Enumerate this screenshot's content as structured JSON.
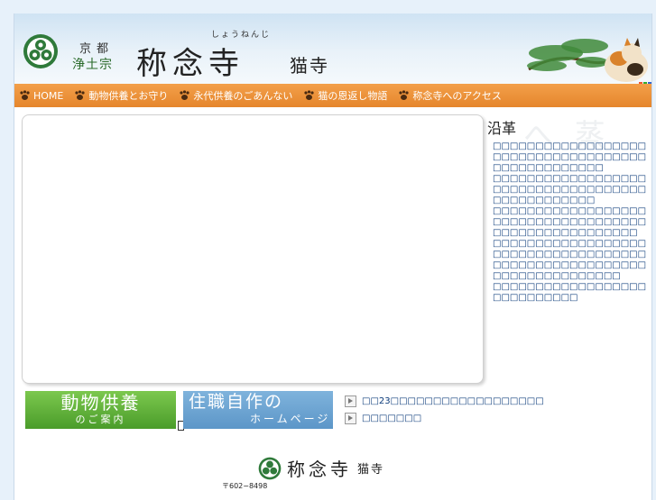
{
  "header": {
    "kyoto": "京都",
    "jodo": "浄土宗",
    "reading": "しょうねんじ",
    "temple_name": "称念寺",
    "nekodera": "猫寺"
  },
  "nav": {
    "items": [
      {
        "label": "HOME"
      },
      {
        "label": "動物供養とお守り"
      },
      {
        "label": "永代供養のごあんない"
      },
      {
        "label": "猫の恩返し物語"
      },
      {
        "label": "称念寺へのアクセス"
      }
    ]
  },
  "side": {
    "title": "沿革",
    "bg_kanji": "へ 蒸",
    "paragraphs": [
      "□□□□□□□□□□□□□□□□□□□□□□□□□□□□□□□□□□□□□□□□□□□□□□□□□",
      "□□□□□□□□□□□□□□□□□□□□□□□□□□□□□□□□□□□□□□□□□□□□□□□□",
      "□□□□□□□□□□□□□□□□□□□□□□□□□□□□□□□□□□□□□□□□□□□□□□□□□□□□□",
      "□□□□□□□□□□□□□□□□□□□□□□□□□□□□□□□□□□□□□□□□□□□□□□□□□□□□□□□□□□□□□□□□□□□□□",
      "□□□□□□□□□□□□□□□□□□□□□□□□□□□□"
    ]
  },
  "banners": {
    "b1_main": "動物供養",
    "b1_sub": "のご案内",
    "b2_main": "住職自作の",
    "b2_sub": "ホームページ"
  },
  "links": [
    {
      "label": "□□23□□□□□□□□□□□□□□□□□□"
    },
    {
      "label": "□□□□□□□"
    }
  ],
  "footer": {
    "name": "称念寺",
    "neko": "猫寺",
    "postal": "〒602−8498"
  },
  "colors": {
    "nav_orange": "#e5862c",
    "link_blue": "#0a3a7a",
    "banner_green": "#4a9c2a",
    "banner_blue": "#5c96c8"
  }
}
